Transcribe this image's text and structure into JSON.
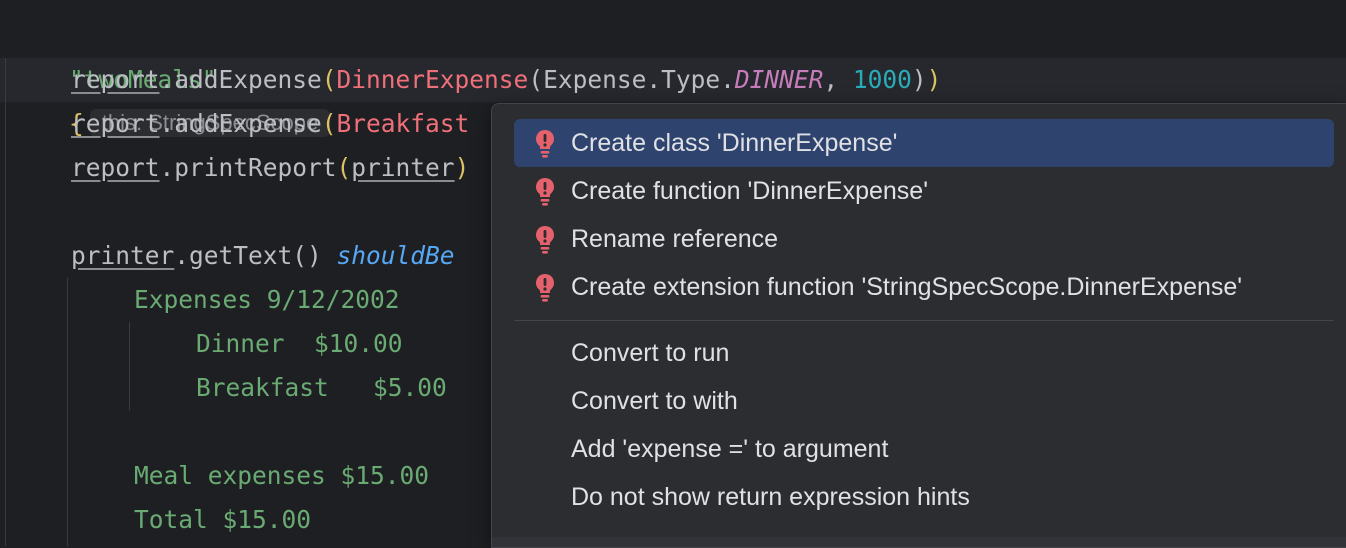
{
  "editor": {
    "test_name": "\"twoMeals\"",
    "open_brace": "{",
    "scope_hint": "this: StringSpecScope",
    "line1": {
      "receiver": "report",
      "dot_call": ".addExpense",
      "open1": "(",
      "ctor": "DinnerExpense",
      "open2": "(",
      "type_path": "Expense.Type.",
      "enum_value": "DINNER",
      "comma": ", ",
      "amount": "1000",
      "close2": ")",
      "close1": ")"
    },
    "line2": {
      "receiver": "report",
      "dot_call": ".addExpense",
      "open1": "(",
      "ctor_partial": "Breakfast"
    },
    "line3": {
      "receiver": "report",
      "dot_call": ".printReport",
      "open1": "(",
      "arg": "printer",
      "close1": ")"
    },
    "line4": {
      "receiver": "printer",
      "dot_call": ".getText()",
      "infix": "shouldBe"
    },
    "string_lines": [
      "Expenses 9/12/2002",
      "Dinner  $10.00",
      "Breakfast   $5.00",
      "Meal expenses $15.00",
      "Total $15.00"
    ]
  },
  "popup": {
    "error_items": [
      "Create class 'DinnerExpense'",
      "Create function 'DinnerExpense'",
      "Rename reference",
      "Create extension function 'StringSpecScope.DinnerExpense'"
    ],
    "other_items": [
      "Convert to run",
      "Convert to with",
      "Add 'expense =' to argument",
      "Do not show return expression hints"
    ],
    "selected_index": 0,
    "error_bulb_icon": "red-bulb-icon",
    "colors": {
      "selection": "#2e436e",
      "bulb": "#e5616b",
      "background": "#2b2d30"
    }
  }
}
